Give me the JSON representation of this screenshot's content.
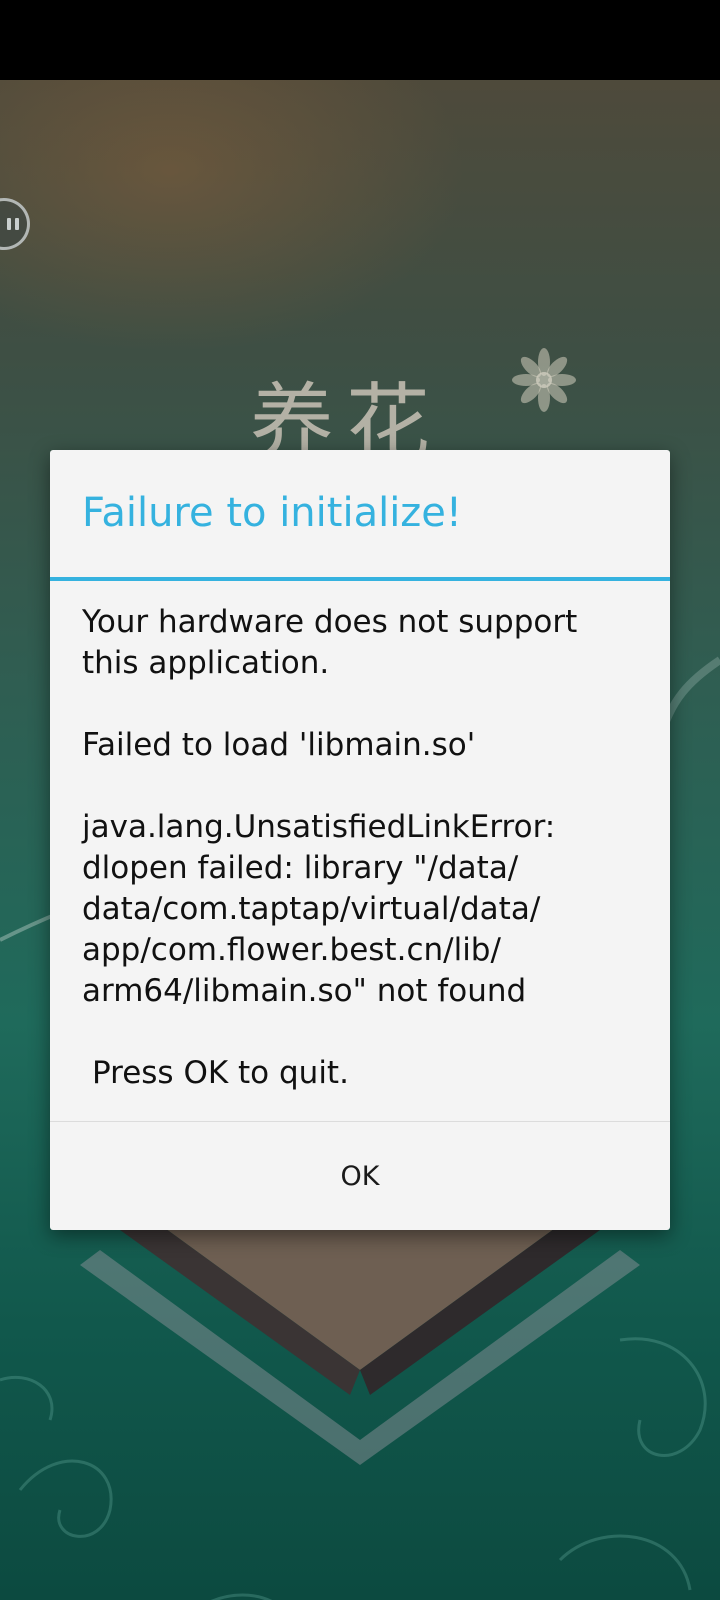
{
  "dialog": {
    "title": "Failure to initialize!",
    "message": {
      "line_1": "Your hardware does not support",
      "line_2": "this application.",
      "line_3": "Failed to load 'libmain.so'",
      "line_4": "java.lang.UnsatisfiedLinkError:",
      "line_5": "dlopen failed: library \"/data/",
      "line_6": "data/com.taptap/virtual/data/",
      "line_7": "app/com.flower.best.cn/lib/",
      "line_8": "arm64/libmain.so\" not found",
      "line_9": "Press OK to quit."
    },
    "ok_label": "OK"
  },
  "background": {
    "title_art_glyphs": "养花"
  },
  "icons": {
    "pause": "pause-icon",
    "flower": "flower-icon"
  },
  "colors": {
    "accent": "#35b2df",
    "dialog_bg": "#f4f4f4",
    "status_bar": "#000000",
    "backdrop_top": "#4e4a3b",
    "backdrop_bottom": "#0c4a40"
  }
}
